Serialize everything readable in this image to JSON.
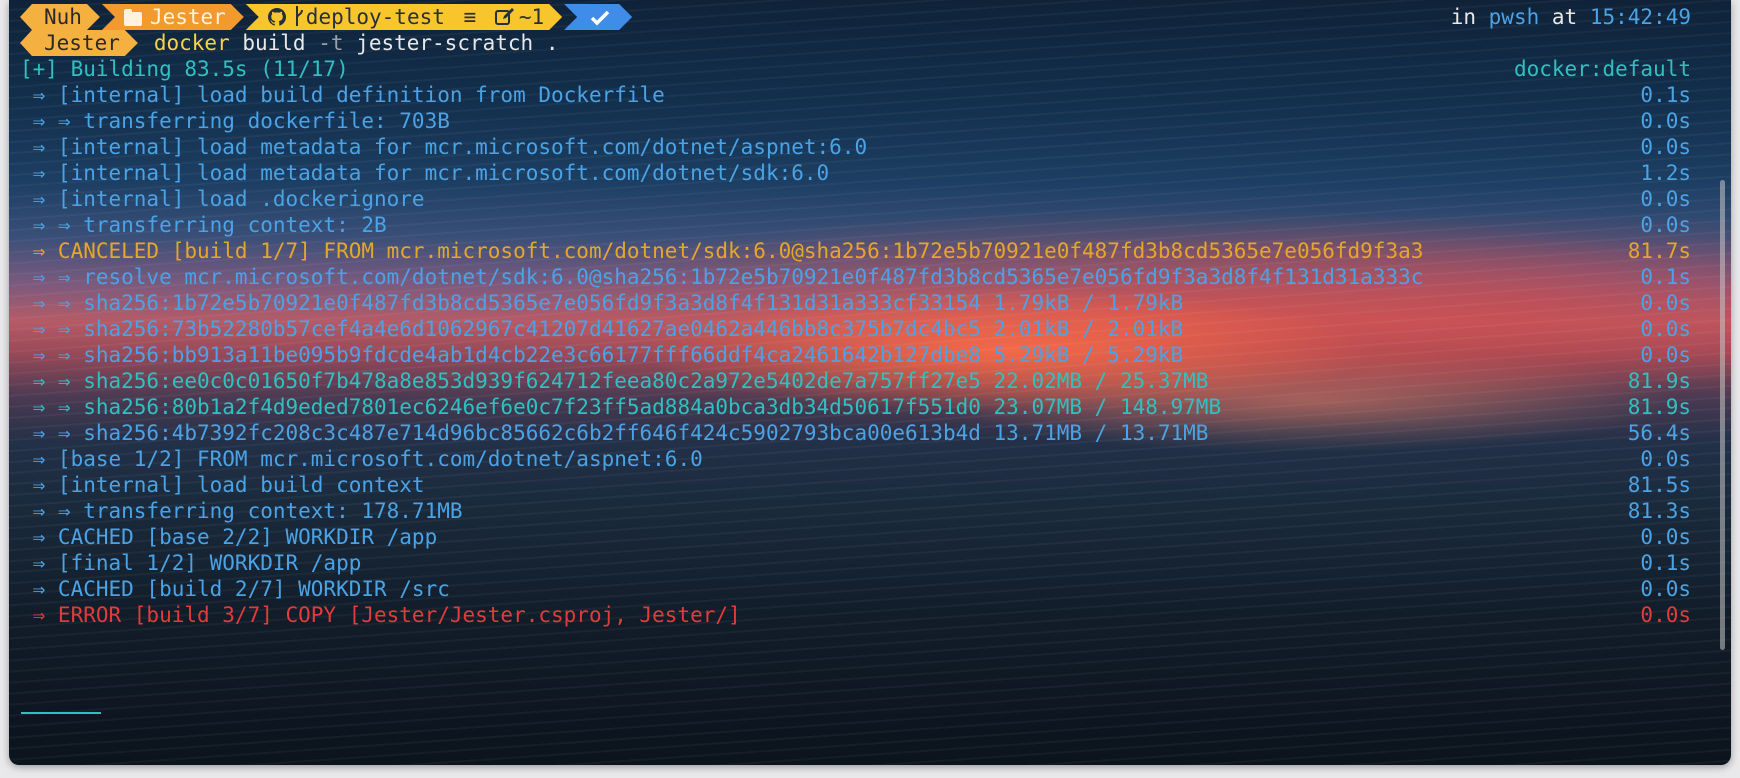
{
  "prompt": {
    "user": "Nuh",
    "dir": "Jester",
    "git_branch": "deploy-test",
    "git_stash": "≡",
    "git_changes": "~1",
    "status_icon": "check-icon",
    "shell_label": "in",
    "shell": "pwsh",
    "time_label": "at",
    "time": "15:42:49"
  },
  "command_line": {
    "dir": "Jester",
    "cmd": "docker",
    "args_a": " build ",
    "flag": "-t",
    "args_b": " jester-scratch ."
  },
  "lines": [
    {
      "text": "[+] Building 83.5s (11/17)",
      "time": "docker:default",
      "color": "#2fc1c1"
    },
    {
      "text": " ⇒ [internal] load build definition from Dockerfile",
      "time": "0.1s",
      "color": "#4aa3e6"
    },
    {
      "text": " ⇒ ⇒ transferring dockerfile: 703B",
      "time": "0.0s",
      "color": "#4aa3e6"
    },
    {
      "text": " ⇒ [internal] load metadata for mcr.microsoft.com/dotnet/aspnet:6.0",
      "time": "0.0s",
      "color": "#4aa3e6"
    },
    {
      "text": " ⇒ [internal] load metadata for mcr.microsoft.com/dotnet/sdk:6.0",
      "time": "1.2s",
      "color": "#4aa3e6"
    },
    {
      "text": " ⇒ [internal] load .dockerignore",
      "time": "0.0s",
      "color": "#4aa3e6"
    },
    {
      "text": " ⇒ ⇒ transferring context: 2B",
      "time": "0.0s",
      "color": "#4aa3e6"
    },
    {
      "text": " ⇒ CANCELED [build 1/7] FROM mcr.microsoft.com/dotnet/sdk:6.0@sha256:1b72e5b70921e0f487fd3b8cd5365e7e056fd9f3a3",
      "time": "81.7s",
      "color": "#e5a72a"
    },
    {
      "text": " ⇒ ⇒ resolve mcr.microsoft.com/dotnet/sdk:6.0@sha256:1b72e5b70921e0f487fd3b8cd5365e7e056fd9f3a3d8f4f131d31a333c",
      "time": "0.1s",
      "color": "#4aa3e6"
    },
    {
      "text": " ⇒ ⇒ sha256:1b72e5b70921e0f487fd3b8cd5365e7e056fd9f3a3d8f4f131d31a333cf33154 1.79kB / 1.79kB",
      "time": "0.0s",
      "color": "#4aa3e6"
    },
    {
      "text": " ⇒ ⇒ sha256:73b52280b57cef4a4e6d1062967c41207d41627ae0462a446bb8c375b7dc4bc5 2.01kB / 2.01kB",
      "time": "0.0s",
      "color": "#4aa3e6"
    },
    {
      "text": " ⇒ ⇒ sha256:bb913a11be095b9fdcde4ab1d4cb22e3c66177fff66ddf4ca2461642b127dbe8 5.29kB / 5.29kB",
      "time": "0.0s",
      "color": "#4aa3e6"
    },
    {
      "text": " ⇒ ⇒ sha256:ee0c0c01650f7b478a8e853d939f624712feea80c2a972e5402de7a757ff27e5 22.02MB / 25.37MB",
      "time": "81.9s",
      "color": "#2fc1c1"
    },
    {
      "text": " ⇒ ⇒ sha256:80b1a2f4d9eded7801ec6246ef6e0c7f23ff5ad884a0bca3db34d50617f551d0 23.07MB / 148.97MB",
      "time": "81.9s",
      "color": "#2fc1c1"
    },
    {
      "text": " ⇒ ⇒ sha256:4b7392fc208c3c487e714d96bc85662c6b2ff646f424c5902793bca00e613b4d 13.71MB / 13.71MB",
      "time": "56.4s",
      "color": "#4aa3e6"
    },
    {
      "text": " ⇒ [base 1/2] FROM mcr.microsoft.com/dotnet/aspnet:6.0",
      "time": "0.0s",
      "color": "#4aa3e6"
    },
    {
      "text": " ⇒ [internal] load build context",
      "time": "81.5s",
      "color": "#4aa3e6"
    },
    {
      "text": " ⇒ ⇒ transferring context: 178.71MB",
      "time": "81.3s",
      "color": "#4aa3e6"
    },
    {
      "text": " ⇒ CACHED [base 2/2] WORKDIR /app",
      "time": "0.0s",
      "color": "#4aa3e6"
    },
    {
      "text": " ⇒ [final 1/2] WORKDIR /app",
      "time": "0.1s",
      "color": "#4aa3e6"
    },
    {
      "text": " ⇒ CACHED [build 2/7] WORKDIR /src",
      "time": "0.0s",
      "color": "#4aa3e6"
    },
    {
      "text": " ⇒ ERROR [build 3/7] COPY [Jester/Jester.csproj, Jester/]",
      "time": "0.0s",
      "color": "#e33b3b"
    }
  ]
}
